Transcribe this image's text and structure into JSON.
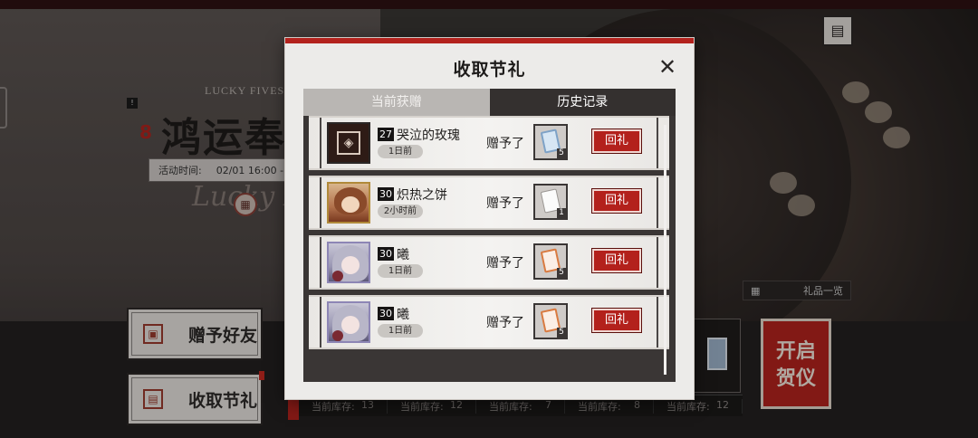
{
  "background": {
    "lucky_text": "LUCKY FIVES",
    "event_title": "鸿运奉",
    "badge": "!",
    "event_number_mark": "8",
    "time_label": "活动时间:",
    "time_value": "02/01 16:00 -",
    "cursive_text": "Lucky Fi",
    "side_buttons": [
      {
        "label": "赠予好友",
        "icon": "gift-icon"
      },
      {
        "label": "收取节礼",
        "icon": "receive-icon"
      }
    ],
    "gift_list_label": "礼品一览",
    "open_ceremony_label": [
      "开启",
      "贺仪"
    ],
    "stock": [
      {
        "label": "当前库存:",
        "value": "13"
      },
      {
        "label": "当前库存:",
        "value": "12"
      },
      {
        "label": "当前库存:",
        "value": "7"
      },
      {
        "label": "当前库存:",
        "value": "8"
      },
      {
        "label": "当前库存:",
        "value": "12"
      }
    ]
  },
  "modal": {
    "title": "收取节礼",
    "close_symbol": "✕",
    "tabs": [
      {
        "label": "当前获赠",
        "active": false
      },
      {
        "label": "历史记录",
        "active": true
      }
    ],
    "gave_text": "赠予了",
    "return_label": "回礼",
    "rows": [
      {
        "level": "27",
        "name": "哭泣的玫瑰",
        "time": "1日前",
        "avatar": "emblem-avatar",
        "gift_icon": "blue-card-icon",
        "gift_count": "5"
      },
      {
        "level": "30",
        "name": "炽热之饼",
        "time": "2小时前",
        "avatar": "brown-hair-avatar",
        "gift_icon": "panda-card-icon",
        "gift_count": "1"
      },
      {
        "level": "30",
        "name": "曦",
        "time": "1日前",
        "avatar": "silver-hair-avatar",
        "gift_icon": "orange-card-icon",
        "gift_count": "5"
      },
      {
        "level": "30",
        "name": "曦",
        "time": "1日前",
        "avatar": "silver-hair-avatar",
        "gift_icon": "orange-card-icon",
        "gift_count": "5"
      }
    ]
  },
  "colors": {
    "accent_red": "#b3211c",
    "dark": "#34302f",
    "modal_bg": "#ecebe9"
  }
}
